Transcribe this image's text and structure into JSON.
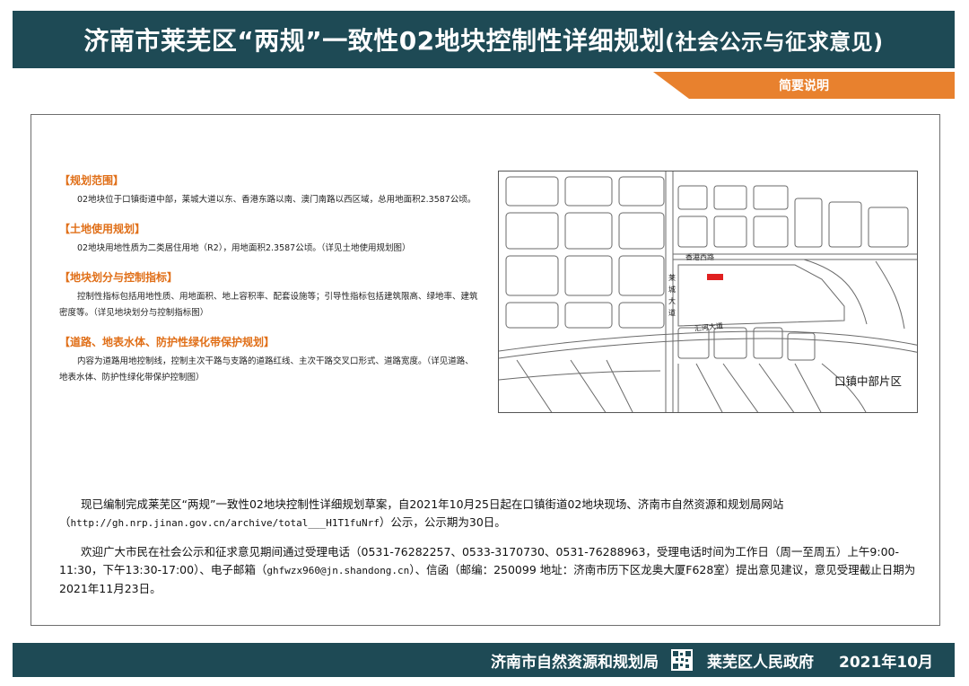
{
  "header": {
    "title": "济南市莱芜区“两规”一致性02地块控制性详细规划",
    "title_suffix": "(社会公示与征求意见)",
    "section_tab": "简要说明"
  },
  "sections": [
    {
      "heading": "【规划范围】",
      "body": "02地块位于口镇街道中部，莱城大道以东、香港东路以南、澳门南路以西区域，总用地面积2.3587公顷。"
    },
    {
      "heading": "【土地使用规划】",
      "body": "02地块用地性质为二类居住用地（R2），用地面积2.3587公顷。（详见土地使用规划图）"
    },
    {
      "heading": "【地块划分与控制指标】",
      "body": "控制性指标包括用地性质、用地面积、地上容积率、配套设施等；引导性指标包括建筑限高、绿地率、建筑密度等。（详见地块划分与控制指标图）"
    },
    {
      "heading": "【道路、地表水体、防护性绿化带保护规划】",
      "body": "内容为道路用地控制线，控制主次干路与支路的道路红线、主次干路交叉口形式、道路宽度。（详见道路、地表水体、防护性绿化带保护控制图）"
    }
  ],
  "map": {
    "road_top": "香港西路",
    "road_vertical": "莱城大道",
    "road_diagonal": "汇河大道",
    "area_label": "口镇中部片区",
    "site_color": "#e02020"
  },
  "notice": {
    "p1_a": "现已编制完成莱芜区“两规”一致性02地块控制性详细规划草案，自2021年10月25日起在口镇街道02地块现场、济南市自然资源和规划局网站（",
    "p1_url": "http://gh.nrp.jinan.gov.cn/archive/total___H1T1fuNrf",
    "p1_b": "）公示，公示期为30日。",
    "p2_a": "欢迎广大市民在社会公示和征求意见期间通过受理电话（",
    "p2_phones": "0531-76282257、0533-3170730、0531-76288963",
    "p2_b": "，受理电话时间为工作日（周一至周五）上午",
    "p2_times": "9:00-11:30，下午13:30-17:00",
    "p2_c": "）、电子邮箱（",
    "p2_email": "ghfwzx960@jn.shandong.cn",
    "p2_d": "）、信函（邮编：250099 地址：济南市历下区龙奥大厦F628室）提出意见建议，意见受理截止日期为2021年11月23日。"
  },
  "footer": {
    "org1": "济南市自然资源和规划局",
    "org2": "莱芜区人民政府",
    "date": "2021年10月"
  },
  "colors": {
    "header_bg": "#1e4a55",
    "accent_orange": "#e8812e",
    "heading_orange": "#e06f18"
  }
}
